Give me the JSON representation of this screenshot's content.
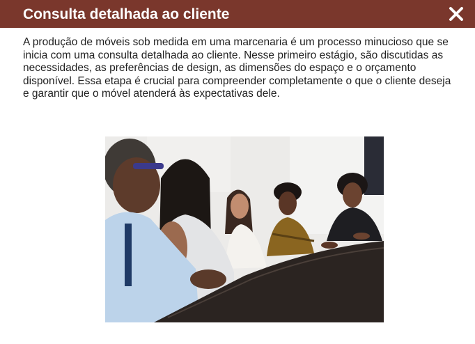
{
  "dialog": {
    "title": "Consulta detalhada ao cliente",
    "close_icon": "close-icon",
    "body": "A produção de móveis sob medida em uma marcenaria é um processo minucioso que se inicia com uma consulta detalhada ao cliente. Nesse primeiro estágio, são discutidas as necessidades, as preferências de design, as dimensões do espaço e o orçamento disponível. Essa etapa é crucial para compreender completamente o que o cliente deseja e garantir que o móvel atenderá às expectativas dele.",
    "image_subject": "meeting-photo",
    "colors": {
      "header_bg": "#7a372c",
      "header_text": "#ffffff",
      "body_text": "#1f1f1f"
    }
  }
}
